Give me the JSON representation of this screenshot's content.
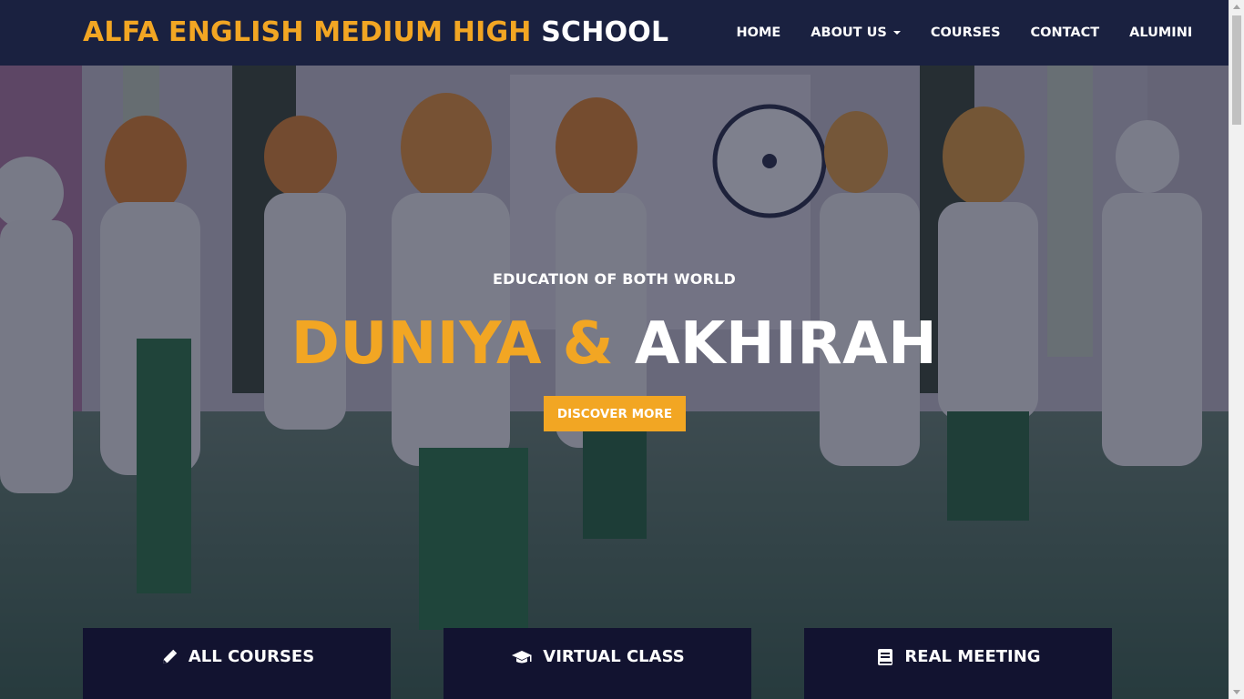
{
  "brand": {
    "accent_text": "ALFA ENGLISH MEDIUM HIGH",
    "rest_text": "SCHOOL"
  },
  "nav": {
    "items": [
      {
        "label": "HOME"
      },
      {
        "label": "ABOUT US",
        "dropdown": true
      },
      {
        "label": "COURSES"
      },
      {
        "label": "CONTACT"
      },
      {
        "label": "ALUMINI"
      }
    ]
  },
  "hero": {
    "subtitle": "EDUCATION OF BOTH WORLD",
    "title_part1": "DUNIYA",
    "title_part2": "&",
    "title_part3": "AKHIRAH",
    "cta_label": "DISCOVER MORE"
  },
  "features": [
    {
      "icon": "pencil-icon",
      "label": "ALL COURSES"
    },
    {
      "icon": "graduation-cap-icon",
      "label": "VIRTUAL CLASS"
    },
    {
      "icon": "book-icon",
      "label": "REAL MEETING"
    }
  ],
  "colors": {
    "navbar_bg": "#1a2140",
    "accent": "#f2a623",
    "feature_bg": "#121330",
    "text_light": "#ffffff"
  }
}
